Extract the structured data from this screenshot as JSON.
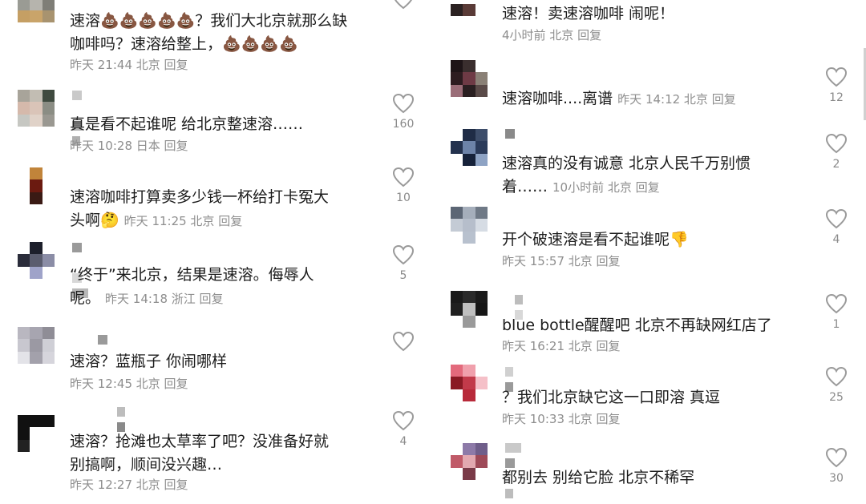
{
  "left_comments": [
    {
      "text_lines": [
        "速溶💩💩💩💩💩？我们大北京就那么缺",
        "咖啡吗？速溶给整上，💩💩💩💩"
      ],
      "meta": "昨天 21:44 北京 回复",
      "likes": ""
    },
    {
      "text_lines": [
        "真是看不起谁呢 给北京整速溶……"
      ],
      "meta": "昨天 10:28 日本 回复",
      "likes": "160"
    },
    {
      "text_lines": [
        "速溶咖啡打算卖多少钱一杯给打卡冤大",
        "头啊🤔"
      ],
      "meta": "昨天 11:25 北京 回复",
      "likes": "10"
    },
    {
      "text_lines": [
        "“终于”来北京，结果是速溶。侮辱人",
        "呢。"
      ],
      "meta": "昨天 14:18 浙江 回复",
      "likes": "5"
    },
    {
      "text_lines": [
        "速溶？蓝瓶子 你闹哪样"
      ],
      "meta": "昨天 12:45 北京 回复",
      "likes": ""
    },
    {
      "text_lines": [
        "速溶？抢滩也太草率了吧？没准备好就",
        "别搞啊，顺间没兴趣…"
      ],
      "meta": "昨天 12:27 北京 回复",
      "likes": "4"
    }
  ],
  "right_comments": [
    {
      "text_lines": [
        "速溶！卖速溶咖啡 闹呢！"
      ],
      "meta": "4小时前 北京 回复",
      "likes": ""
    },
    {
      "text_lines": [
        "速溶咖啡....离谱"
      ],
      "meta": "昨天 14:12 北京 回复",
      "likes": "12"
    },
    {
      "text_lines": [
        "速溶真的没有诚意 北京人民千万别惯",
        "着……"
      ],
      "meta": "10小时前 北京 回复",
      "likes": "2"
    },
    {
      "text_lines": [
        "开个破速溶是看不起谁呢👎"
      ],
      "meta": "昨天 15:57 北京 回复",
      "likes": "4"
    },
    {
      "text_lines": [
        "blue bottle醒醒吧 北京不再缺网红店了"
      ],
      "meta": "昨天 16:21 北京 回复",
      "likes": "1"
    },
    {
      "text_lines": [
        "？我们北京缺它这一口即溶 真逗"
      ],
      "meta": "昨天 10:33 北京 回复",
      "likes": "25"
    },
    {
      "text_lines": [
        "都别去 别给它脸 北京不稀罕"
      ],
      "meta": "",
      "likes": "30"
    }
  ],
  "colors": {
    "text": "#1c1c1c",
    "meta": "#8e8e8e",
    "like_icon": "#9a9a9a",
    "background": "#ffffff"
  },
  "icons": {
    "like": "heart-outline-icon"
  }
}
